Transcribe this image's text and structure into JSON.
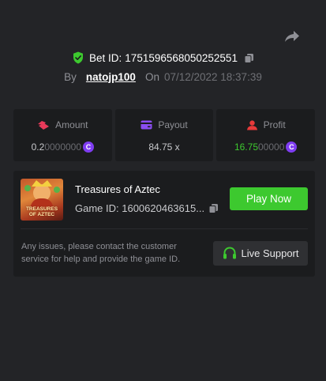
{
  "bet": {
    "id_label": "Bet ID:",
    "id_value": "1751596568050252551",
    "by_label": "By",
    "username": "natojp100",
    "on_label": "On",
    "datetime": "07/12/2022 18:37:39"
  },
  "stats": {
    "amount": {
      "label": "Amount",
      "value_main": "0.2",
      "value_dim": "0000000",
      "coin": "C"
    },
    "payout": {
      "label": "Payout",
      "value": "84.75 x"
    },
    "profit": {
      "label": "Profit",
      "value_main": "16.75",
      "value_dim": "00000",
      "coin": "C"
    }
  },
  "game": {
    "thumb_label_line1": "TREASURES",
    "thumb_label_line2": "OF AZTEC",
    "title": "Treasures of Aztec",
    "id_text": "Game ID: 1600620463615...",
    "play_label": "Play Now"
  },
  "support": {
    "text": "Any issues, please contact the customer service for help and provide the game ID.",
    "button_label": "Live Support"
  },
  "colors": {
    "background": "#232427",
    "card": "#1b1c1e",
    "accent_green": "#3dc92f",
    "coin_purple": "#7f3df2",
    "shield_green": "#3dc92f",
    "amount_icon": "#e83a5a",
    "payout_icon": "#8a4df0",
    "profit_icon": "#e83a3a"
  },
  "icons": [
    "share-icon",
    "shield-check-icon",
    "copy-icon",
    "amount-icon",
    "payout-card-icon",
    "profit-user-icon",
    "coin-icon",
    "headset-icon"
  ]
}
